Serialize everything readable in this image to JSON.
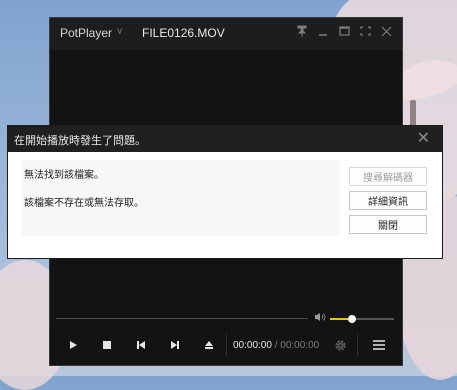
{
  "player": {
    "brand": "PotPlayer",
    "brand_caret": "∨",
    "filename": "FILE0126.MOV",
    "window_controls": [
      "pin-icon",
      "minimize-icon",
      "maximize-icon",
      "fullscreen-icon",
      "close-icon"
    ],
    "volume_level": 0.35,
    "controls": [
      "play-icon",
      "stop-icon",
      "previous-icon",
      "next-icon",
      "eject-icon"
    ],
    "time_current": "00:00:00",
    "time_separator": "/",
    "time_total": "00:00:00"
  },
  "dialog": {
    "title": "在開始播放時發生了問題。",
    "close": "✕",
    "message1": "無法找到該檔案。",
    "message2": "該檔案不存在或無法存取。",
    "buttons": {
      "search_codec": "搜尋解碼器",
      "details": "詳細資訊",
      "close": "關閉"
    }
  },
  "colors": {
    "player_bg": "#131313",
    "accent_volume": "#f0c000",
    "dialog_bg": "#ffffff",
    "dialog_title_bg": "#202020"
  }
}
